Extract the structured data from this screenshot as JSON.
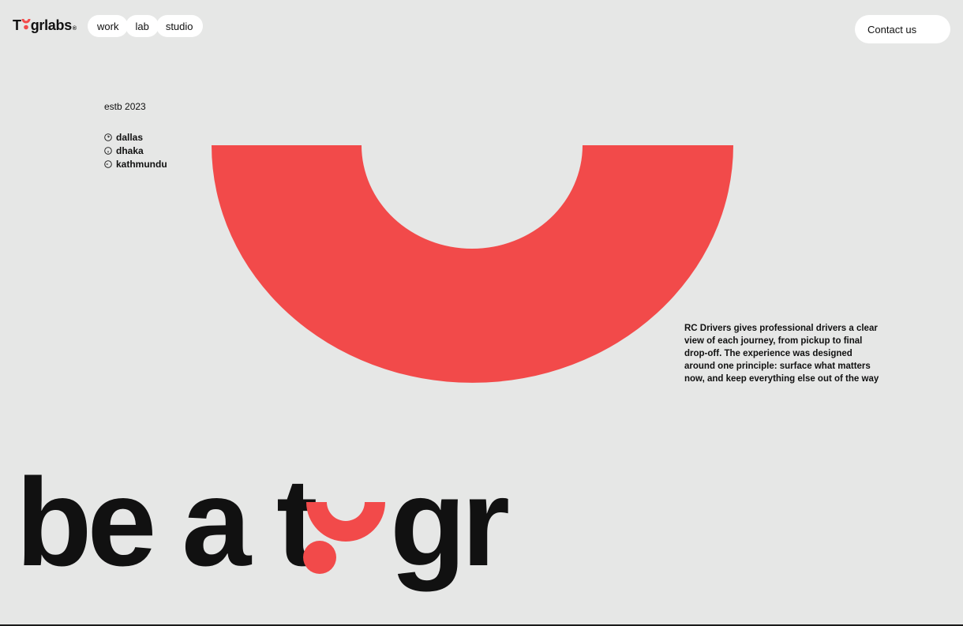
{
  "brand": {
    "name_prefix": "T",
    "name_suffix": "grlabs",
    "registered": "®",
    "accent": "#f24a4a"
  },
  "nav": {
    "items": [
      {
        "label": "work"
      },
      {
        "label": "lab"
      },
      {
        "label": "studio"
      }
    ]
  },
  "header": {
    "contact_label": "Contact us"
  },
  "info": {
    "established": "estb 2023",
    "cities": [
      {
        "name": "dallas",
        "icon": "clock-icon"
      },
      {
        "name": "dhaka",
        "icon": "clock-icon"
      },
      {
        "name": "kathmundu",
        "icon": "clock-icon"
      }
    ]
  },
  "description": "RC Drivers gives professional drivers a clear view of each journey, from pickup to final drop-off. The experience was designed around one principle: surface what matters now, and keep everything else out of the way",
  "hero": {
    "text_part1": "be a t",
    "text_part2": "gr"
  }
}
